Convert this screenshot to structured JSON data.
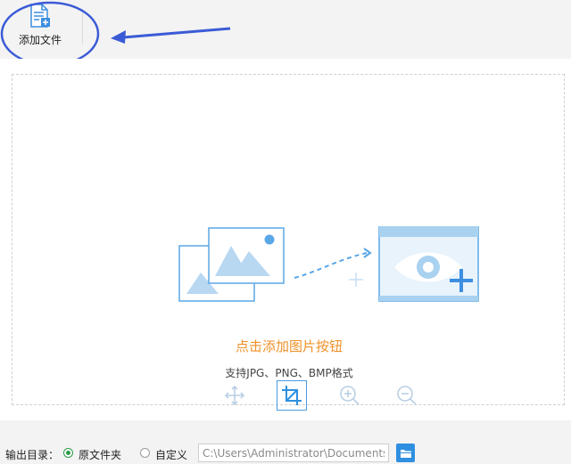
{
  "toolbar": {
    "add_file_label": "添加文件"
  },
  "drop_zone": {
    "hint_main": "点击添加图片按钮",
    "hint_sub": "支持JPG、PNG、BMP格式"
  },
  "image_tools": [
    {
      "name": "move",
      "icon": "move-arrows-icon",
      "active": false
    },
    {
      "name": "crop",
      "icon": "crop-icon",
      "active": true
    },
    {
      "name": "zoom-in",
      "icon": "zoom-in-icon",
      "active": false
    },
    {
      "name": "zoom-out",
      "icon": "zoom-out-icon",
      "active": false
    }
  ],
  "output": {
    "label": "输出目录：",
    "options": [
      {
        "label": "原文件夹",
        "checked": true
      },
      {
        "label": "自定义",
        "checked": false
      }
    ],
    "path_value": "C:\\Users\\Administrator\\Documents"
  },
  "colors": {
    "accent_orange": "#f0922b",
    "accent_blue": "#4a9ce0",
    "annotation_blue": "#3b5bd6",
    "radio_green": "#2c9a4a"
  }
}
